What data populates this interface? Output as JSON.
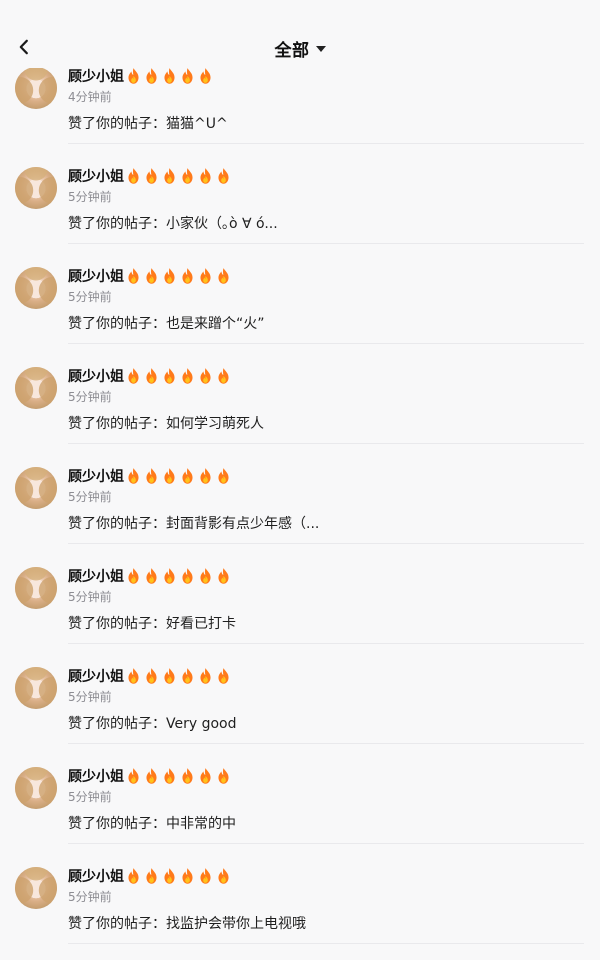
{
  "header": {
    "filter_label": "全部",
    "back_icon": "chevron-left-icon",
    "dropdown_icon": "caret-down-icon"
  },
  "colors": {
    "background": "#f8f8f9",
    "divider": "#e9e9ec",
    "flame": "#ff7a1a",
    "time_text": "#8d8d93"
  },
  "notifications": [
    {
      "name": "顾少小姐",
      "flames": 5,
      "time": "4分钟前",
      "text": "赞了你的帖子：猫猫^U^"
    },
    {
      "name": "顾少小姐",
      "flames": 6,
      "time": "5分钟前",
      "text": "赞了你的帖子：小家伙（｡ò ∀ ó..."
    },
    {
      "name": "顾少小姐",
      "flames": 6,
      "time": "5分钟前",
      "text": "赞了你的帖子：也是来蹭个“火”"
    },
    {
      "name": "顾少小姐",
      "flames": 6,
      "time": "5分钟前",
      "text": "赞了你的帖子：如何学习萌死人"
    },
    {
      "name": "顾少小姐",
      "flames": 6,
      "time": "5分钟前",
      "text": "赞了你的帖子：封面背影有点少年感（..."
    },
    {
      "name": "顾少小姐",
      "flames": 6,
      "time": "5分钟前",
      "text": "赞了你的帖子：好看已打卡"
    },
    {
      "name": "顾少小姐",
      "flames": 6,
      "time": "5分钟前",
      "text": "赞了你的帖子：Very good"
    },
    {
      "name": "顾少小姐",
      "flames": 6,
      "time": "5分钟前",
      "text": "赞了你的帖子：中非常的中"
    },
    {
      "name": "顾少小姐",
      "flames": 6,
      "time": "5分钟前",
      "text": "赞了你的帖子：找监护会带你上电视哦"
    }
  ]
}
